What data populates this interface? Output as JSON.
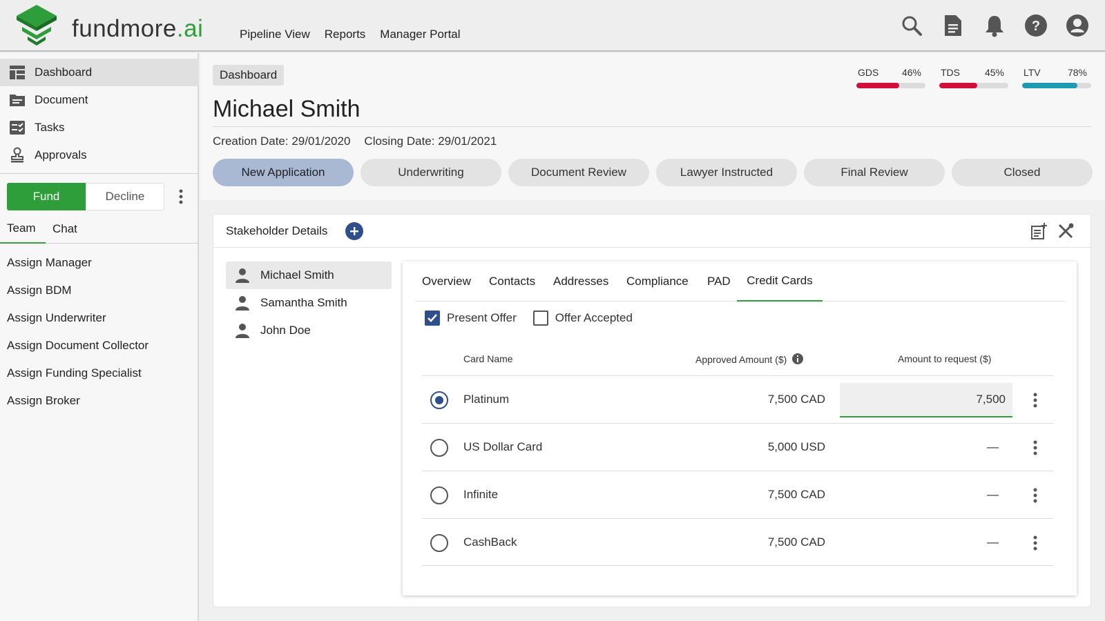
{
  "app": {
    "logo_main": "fundmore",
    "logo_tld": ".ai"
  },
  "topnav": [
    "Pipeline View",
    "Reports",
    "Manager Portal"
  ],
  "header_icons": [
    "search-icon",
    "document-icon",
    "bell-icon",
    "help-icon",
    "account-icon"
  ],
  "sidebar": {
    "items": [
      {
        "label": "Dashboard",
        "icon": "dashboard-icon",
        "active": true
      },
      {
        "label": "Document",
        "icon": "document-icon",
        "active": false
      },
      {
        "label": "Tasks",
        "icon": "tasks-icon",
        "active": false
      },
      {
        "label": "Approvals",
        "icon": "approvals-icon",
        "active": false
      }
    ],
    "fund_label": "Fund",
    "decline_label": "Decline",
    "tabs": [
      "Team",
      "Chat"
    ],
    "assign": [
      "Assign Manager",
      "Assign BDM",
      "Assign Underwriter",
      "Assign Document Collector",
      "Assign Funding Specialist",
      "Assign Broker"
    ]
  },
  "main": {
    "breadcrumb": "Dashboard",
    "title": "Michael Smith",
    "creation_date": "Creation Date: 29/01/2020",
    "closing_date": "Closing Date: 29/01/2021",
    "metrics": [
      {
        "label": "GDS",
        "value": "46%",
        "fraction": 0.62,
        "color": "#d0103a"
      },
      {
        "label": "TDS",
        "value": "45%",
        "fraction": 0.55,
        "color": "#d0103a"
      },
      {
        "label": "LTV",
        "value": "78%",
        "fraction": 0.8,
        "color": "#1e9bb0"
      }
    ],
    "stages": [
      "New Application",
      "Underwriting",
      "Document Review",
      "Lawyer Instructed",
      "Final Review",
      "Closed"
    ],
    "active_stage": "New Application"
  },
  "card": {
    "title": "Stakeholder Details",
    "stakeholders": [
      "Michael Smith",
      "Samantha Smith",
      "John Doe"
    ],
    "tabs": [
      "Overview",
      "Contacts",
      "Addresses",
      "Compliance",
      "PAD",
      "Credit Cards"
    ],
    "active_tab": "Credit Cards",
    "present_offer": "Present Offer",
    "offer_accepted": "Offer Accepted",
    "columns": {
      "name": "Card Name",
      "approved": "Approved Amount ($)",
      "request": "Amount to request ($)"
    },
    "rows": [
      {
        "name": "Platinum",
        "approved": "7,500 CAD",
        "request": "7,500",
        "selected": true
      },
      {
        "name": "US Dollar Card",
        "approved": "5,000 USD",
        "request": "—",
        "selected": false
      },
      {
        "name": "Infinite",
        "approved": "7,500 CAD",
        "request": "—",
        "selected": false
      },
      {
        "name": "CashBack",
        "approved": "7,500 CAD",
        "request": "—",
        "selected": false
      }
    ]
  },
  "colors": {
    "brand_green": "#2e9e3a",
    "accent_blue": "#2f4f8a",
    "stage_active": "#a9b9d3"
  }
}
